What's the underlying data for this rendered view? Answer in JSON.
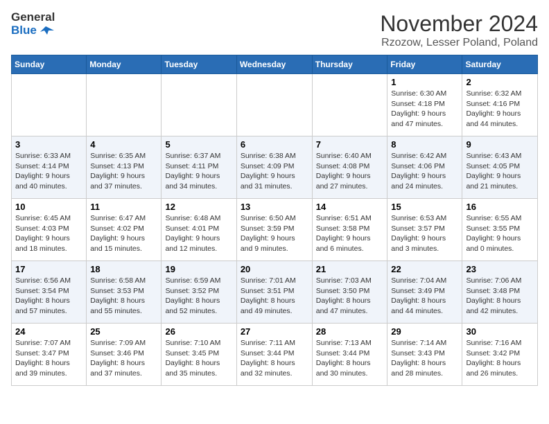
{
  "logo": {
    "text_general": "General",
    "text_blue": "Blue"
  },
  "header": {
    "month_year": "November 2024",
    "location": "Rzozow, Lesser Poland, Poland"
  },
  "weekdays": [
    "Sunday",
    "Monday",
    "Tuesday",
    "Wednesday",
    "Thursday",
    "Friday",
    "Saturday"
  ],
  "weeks": [
    [
      {
        "day": "",
        "info": ""
      },
      {
        "day": "",
        "info": ""
      },
      {
        "day": "",
        "info": ""
      },
      {
        "day": "",
        "info": ""
      },
      {
        "day": "",
        "info": ""
      },
      {
        "day": "1",
        "info": "Sunrise: 6:30 AM\nSunset: 4:18 PM\nDaylight: 9 hours and 47 minutes."
      },
      {
        "day": "2",
        "info": "Sunrise: 6:32 AM\nSunset: 4:16 PM\nDaylight: 9 hours and 44 minutes."
      }
    ],
    [
      {
        "day": "3",
        "info": "Sunrise: 6:33 AM\nSunset: 4:14 PM\nDaylight: 9 hours and 40 minutes."
      },
      {
        "day": "4",
        "info": "Sunrise: 6:35 AM\nSunset: 4:13 PM\nDaylight: 9 hours and 37 minutes."
      },
      {
        "day": "5",
        "info": "Sunrise: 6:37 AM\nSunset: 4:11 PM\nDaylight: 9 hours and 34 minutes."
      },
      {
        "day": "6",
        "info": "Sunrise: 6:38 AM\nSunset: 4:09 PM\nDaylight: 9 hours and 31 minutes."
      },
      {
        "day": "7",
        "info": "Sunrise: 6:40 AM\nSunset: 4:08 PM\nDaylight: 9 hours and 27 minutes."
      },
      {
        "day": "8",
        "info": "Sunrise: 6:42 AM\nSunset: 4:06 PM\nDaylight: 9 hours and 24 minutes."
      },
      {
        "day": "9",
        "info": "Sunrise: 6:43 AM\nSunset: 4:05 PM\nDaylight: 9 hours and 21 minutes."
      }
    ],
    [
      {
        "day": "10",
        "info": "Sunrise: 6:45 AM\nSunset: 4:03 PM\nDaylight: 9 hours and 18 minutes."
      },
      {
        "day": "11",
        "info": "Sunrise: 6:47 AM\nSunset: 4:02 PM\nDaylight: 9 hours and 15 minutes."
      },
      {
        "day": "12",
        "info": "Sunrise: 6:48 AM\nSunset: 4:01 PM\nDaylight: 9 hours and 12 minutes."
      },
      {
        "day": "13",
        "info": "Sunrise: 6:50 AM\nSunset: 3:59 PM\nDaylight: 9 hours and 9 minutes."
      },
      {
        "day": "14",
        "info": "Sunrise: 6:51 AM\nSunset: 3:58 PM\nDaylight: 9 hours and 6 minutes."
      },
      {
        "day": "15",
        "info": "Sunrise: 6:53 AM\nSunset: 3:57 PM\nDaylight: 9 hours and 3 minutes."
      },
      {
        "day": "16",
        "info": "Sunrise: 6:55 AM\nSunset: 3:55 PM\nDaylight: 9 hours and 0 minutes."
      }
    ],
    [
      {
        "day": "17",
        "info": "Sunrise: 6:56 AM\nSunset: 3:54 PM\nDaylight: 8 hours and 57 minutes."
      },
      {
        "day": "18",
        "info": "Sunrise: 6:58 AM\nSunset: 3:53 PM\nDaylight: 8 hours and 55 minutes."
      },
      {
        "day": "19",
        "info": "Sunrise: 6:59 AM\nSunset: 3:52 PM\nDaylight: 8 hours and 52 minutes."
      },
      {
        "day": "20",
        "info": "Sunrise: 7:01 AM\nSunset: 3:51 PM\nDaylight: 8 hours and 49 minutes."
      },
      {
        "day": "21",
        "info": "Sunrise: 7:03 AM\nSunset: 3:50 PM\nDaylight: 8 hours and 47 minutes."
      },
      {
        "day": "22",
        "info": "Sunrise: 7:04 AM\nSunset: 3:49 PM\nDaylight: 8 hours and 44 minutes."
      },
      {
        "day": "23",
        "info": "Sunrise: 7:06 AM\nSunset: 3:48 PM\nDaylight: 8 hours and 42 minutes."
      }
    ],
    [
      {
        "day": "24",
        "info": "Sunrise: 7:07 AM\nSunset: 3:47 PM\nDaylight: 8 hours and 39 minutes."
      },
      {
        "day": "25",
        "info": "Sunrise: 7:09 AM\nSunset: 3:46 PM\nDaylight: 8 hours and 37 minutes."
      },
      {
        "day": "26",
        "info": "Sunrise: 7:10 AM\nSunset: 3:45 PM\nDaylight: 8 hours and 35 minutes."
      },
      {
        "day": "27",
        "info": "Sunrise: 7:11 AM\nSunset: 3:44 PM\nDaylight: 8 hours and 32 minutes."
      },
      {
        "day": "28",
        "info": "Sunrise: 7:13 AM\nSunset: 3:44 PM\nDaylight: 8 hours and 30 minutes."
      },
      {
        "day": "29",
        "info": "Sunrise: 7:14 AM\nSunset: 3:43 PM\nDaylight: 8 hours and 28 minutes."
      },
      {
        "day": "30",
        "info": "Sunrise: 7:16 AM\nSunset: 3:42 PM\nDaylight: 8 hours and 26 minutes."
      }
    ]
  ]
}
